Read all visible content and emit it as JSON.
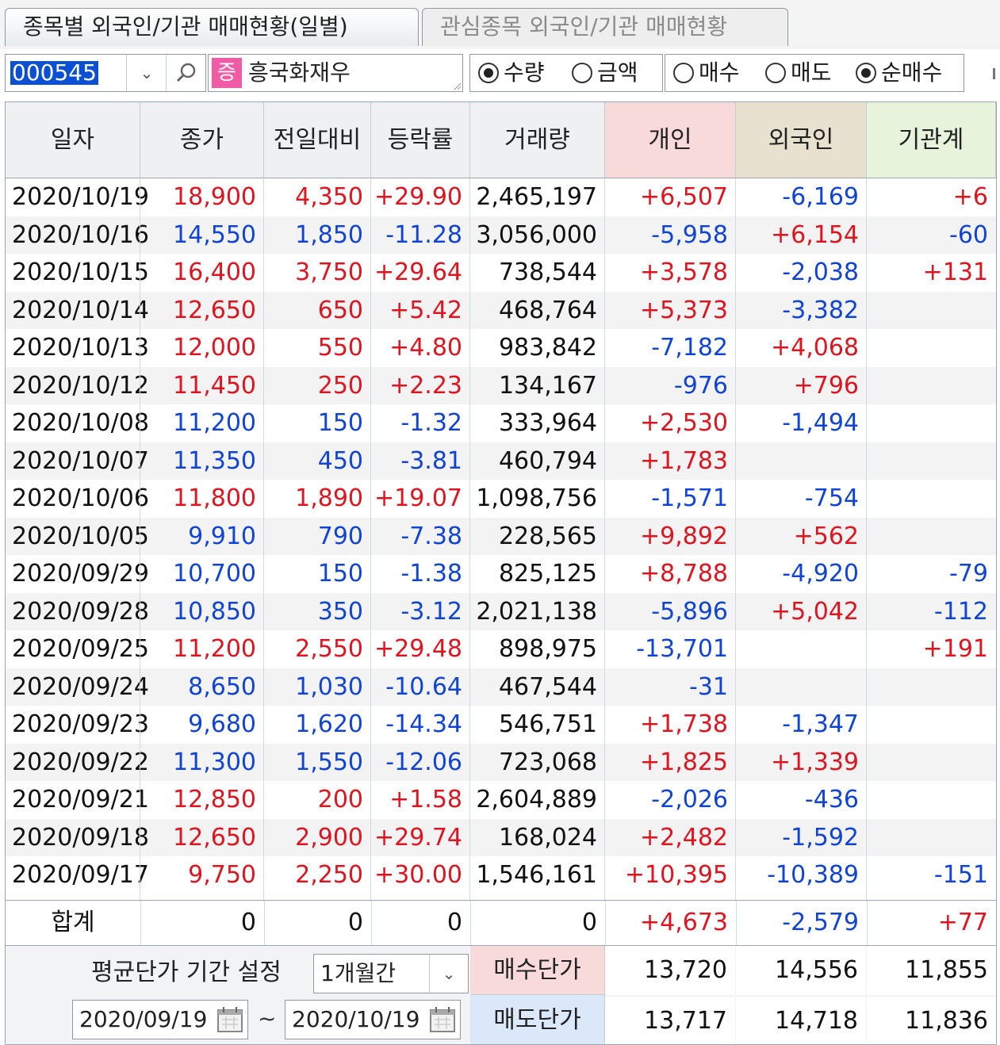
{
  "tabs": [
    {
      "label": "종목별 외국인/기관 매매현황(일별)",
      "active": true
    },
    {
      "label": "관심종목 외국인/기관 매매현황",
      "active": false
    }
  ],
  "toolbar": {
    "code": "000545",
    "badge": "증",
    "stock_name": "흥국화재우",
    "unit_radios": [
      {
        "label": "수량",
        "checked": true
      },
      {
        "label": "금액",
        "checked": false
      }
    ],
    "type_radios": [
      {
        "label": "매수",
        "checked": false
      },
      {
        "label": "매도",
        "checked": false
      },
      {
        "label": "순매수",
        "checked": true
      }
    ]
  },
  "columns": [
    "일자",
    "종가",
    "전일대비",
    "등락률",
    "거래량",
    "개인",
    "외국인",
    "기관계"
  ],
  "header_colors": {
    "individual": "#f9dada",
    "foreign": "#e8e1d0",
    "institution": "#e8f3dc"
  },
  "rows": [
    {
      "date": "2020/10/19",
      "close": "18,900",
      "change": "4,350",
      "rate": "+29.90",
      "volume": "2,465,197",
      "indiv": "+6,507",
      "foreign": "-6,169",
      "inst": "+6",
      "dir": "up"
    },
    {
      "date": "2020/10/16",
      "close": "14,550",
      "change": "1,850",
      "rate": "-11.28",
      "volume": "3,056,000",
      "indiv": "-5,958",
      "foreign": "+6,154",
      "inst": "-60",
      "dir": "down"
    },
    {
      "date": "2020/10/15",
      "close": "16,400",
      "change": "3,750",
      "rate": "+29.64",
      "volume": "738,544",
      "indiv": "+3,578",
      "foreign": "-2,038",
      "inst": "+131",
      "dir": "up"
    },
    {
      "date": "2020/10/14",
      "close": "12,650",
      "change": "650",
      "rate": "+5.42",
      "volume": "468,764",
      "indiv": "+5,373",
      "foreign": "-3,382",
      "inst": "",
      "dir": "up"
    },
    {
      "date": "2020/10/13",
      "close": "12,000",
      "change": "550",
      "rate": "+4.80",
      "volume": "983,842",
      "indiv": "-7,182",
      "foreign": "+4,068",
      "inst": "",
      "dir": "up"
    },
    {
      "date": "2020/10/12",
      "close": "11,450",
      "change": "250",
      "rate": "+2.23",
      "volume": "134,167",
      "indiv": "-976",
      "foreign": "+796",
      "inst": "",
      "dir": "up"
    },
    {
      "date": "2020/10/08",
      "close": "11,200",
      "change": "150",
      "rate": "-1.32",
      "volume": "333,964",
      "indiv": "+2,530",
      "foreign": "-1,494",
      "inst": "",
      "dir": "down"
    },
    {
      "date": "2020/10/07",
      "close": "11,350",
      "change": "450",
      "rate": "-3.81",
      "volume": "460,794",
      "indiv": "+1,783",
      "foreign": "",
      "inst": "",
      "dir": "down"
    },
    {
      "date": "2020/10/06",
      "close": "11,800",
      "change": "1,890",
      "rate": "+19.07",
      "volume": "1,098,756",
      "indiv": "-1,571",
      "foreign": "-754",
      "inst": "",
      "dir": "up"
    },
    {
      "date": "2020/10/05",
      "close": "9,910",
      "change": "790",
      "rate": "-7.38",
      "volume": "228,565",
      "indiv": "+9,892",
      "foreign": "+562",
      "inst": "",
      "dir": "down"
    },
    {
      "date": "2020/09/29",
      "close": "10,700",
      "change": "150",
      "rate": "-1.38",
      "volume": "825,125",
      "indiv": "+8,788",
      "foreign": "-4,920",
      "inst": "-79",
      "dir": "down"
    },
    {
      "date": "2020/09/28",
      "close": "10,850",
      "change": "350",
      "rate": "-3.12",
      "volume": "2,021,138",
      "indiv": "-5,896",
      "foreign": "+5,042",
      "inst": "-112",
      "dir": "down"
    },
    {
      "date": "2020/09/25",
      "close": "11,200",
      "change": "2,550",
      "rate": "+29.48",
      "volume": "898,975",
      "indiv": "-13,701",
      "foreign": "",
      "inst": "+191",
      "dir": "up"
    },
    {
      "date": "2020/09/24",
      "close": "8,650",
      "change": "1,030",
      "rate": "-10.64",
      "volume": "467,544",
      "indiv": "-31",
      "foreign": "",
      "inst": "",
      "dir": "down"
    },
    {
      "date": "2020/09/23",
      "close": "9,680",
      "change": "1,620",
      "rate": "-14.34",
      "volume": "546,751",
      "indiv": "+1,738",
      "foreign": "-1,347",
      "inst": "",
      "dir": "down"
    },
    {
      "date": "2020/09/22",
      "close": "11,300",
      "change": "1,550",
      "rate": "-12.06",
      "volume": "723,068",
      "indiv": "+1,825",
      "foreign": "+1,339",
      "inst": "",
      "dir": "down"
    },
    {
      "date": "2020/09/21",
      "close": "12,850",
      "change": "200",
      "rate": "+1.58",
      "volume": "2,604,889",
      "indiv": "-2,026",
      "foreign": "-436",
      "inst": "",
      "dir": "up"
    },
    {
      "date": "2020/09/18",
      "close": "12,650",
      "change": "2,900",
      "rate": "+29.74",
      "volume": "168,024",
      "indiv": "+2,482",
      "foreign": "-1,592",
      "inst": "",
      "dir": "up"
    },
    {
      "date": "2020/09/17",
      "close": "9,750",
      "change": "2,250",
      "rate": "+30.00",
      "volume": "1,546,161",
      "indiv": "+10,395",
      "foreign": "-10,389",
      "inst": "-151",
      "dir": "up"
    }
  ],
  "summary": {
    "label": "합계",
    "close": "0",
    "change": "0",
    "rate": "0",
    "volume": "0",
    "indiv": "+4,673",
    "foreign": "-2,579",
    "inst": "+77"
  },
  "bottom": {
    "avg_label": "평균단가 기간 설정",
    "period": "1개월간",
    "start_date": "2020/09/19",
    "tilde": "~",
    "end_date": "2020/10/19",
    "buy_label": "매수단가",
    "sell_label": "매도단가",
    "buy": {
      "indiv": "13,720",
      "foreign": "14,556",
      "inst": "11,855"
    },
    "sell": {
      "indiv": "13,717",
      "foreign": "14,718",
      "inst": "11,836"
    }
  },
  "colors": {
    "up": "#e0141e",
    "down": "#1044d8",
    "badge": "#f15ba6",
    "selection": "#0a4fd4"
  }
}
